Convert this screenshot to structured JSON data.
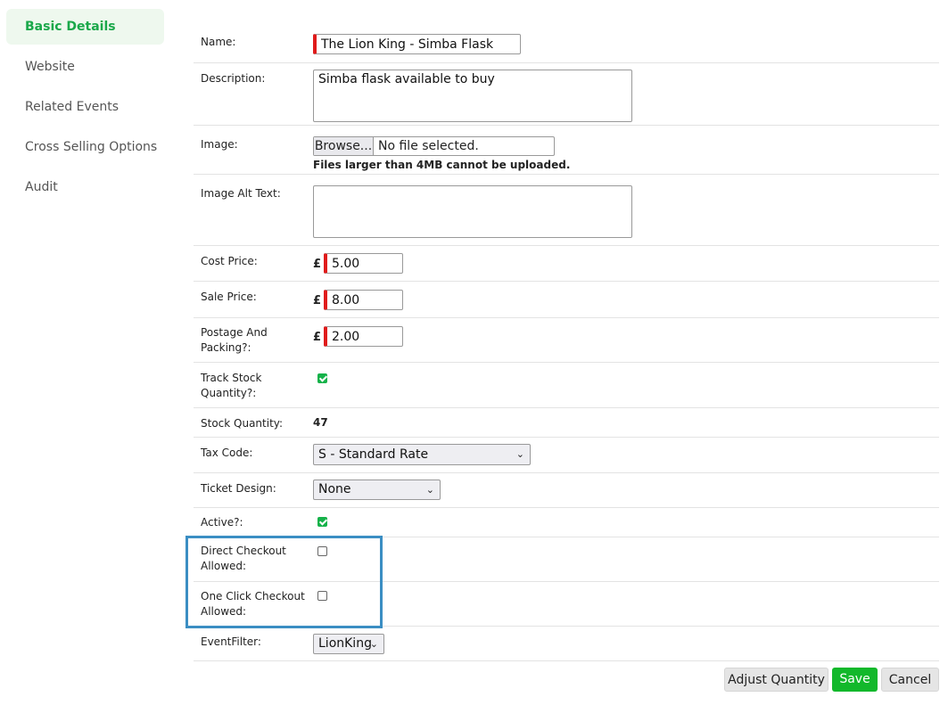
{
  "sidebar": {
    "items": [
      {
        "label": "Basic Details"
      },
      {
        "label": "Website"
      },
      {
        "label": "Related Events"
      },
      {
        "label": "Cross Selling Options"
      },
      {
        "label": "Audit"
      }
    ]
  },
  "form": {
    "name": {
      "label": "Name:",
      "value": "The Lion King - Simba Flask"
    },
    "description": {
      "label": "Description:",
      "value": "Simba flask available to buy"
    },
    "image": {
      "label": "Image:",
      "browse": "Browse...",
      "file_status": "No file selected.",
      "note": "Files larger than 4MB cannot be uploaded."
    },
    "image_alt": {
      "label": "Image Alt Text:",
      "value": ""
    },
    "cost_price": {
      "label": "Cost Price:",
      "currency": "£",
      "value": "5.00"
    },
    "sale_price": {
      "label": "Sale Price:",
      "currency": "£",
      "value": "8.00"
    },
    "postage": {
      "label_1": "Postage And",
      "label_2": "Packing?:",
      "currency": "£",
      "value": "2.00"
    },
    "track_stock": {
      "label_1": "Track Stock",
      "label_2": "Quantity?:",
      "checked": true
    },
    "stock_quantity": {
      "label": "Stock Quantity:",
      "value": "47"
    },
    "tax_code": {
      "label": "Tax Code:",
      "value": "S - Standard Rate"
    },
    "ticket_design": {
      "label": "Ticket Design:",
      "value": "None"
    },
    "active": {
      "label": "Active?:",
      "checked": true
    },
    "direct_checkout": {
      "label_1": "Direct Checkout",
      "label_2": "Allowed:",
      "checked": false
    },
    "one_click_checkout": {
      "label_1": "One Click Checkout",
      "label_2": "Allowed:",
      "checked": false
    },
    "event_filter": {
      "label": "EventFilter:",
      "value": "LionKing"
    }
  },
  "actions": {
    "adjust_quantity": "Adjust Quantity",
    "save": "Save",
    "cancel": "Cancel"
  },
  "colors": {
    "accent_green": "#16b24a",
    "required_red": "#e01b1b",
    "highlight_blue": "#3b8ec3"
  }
}
